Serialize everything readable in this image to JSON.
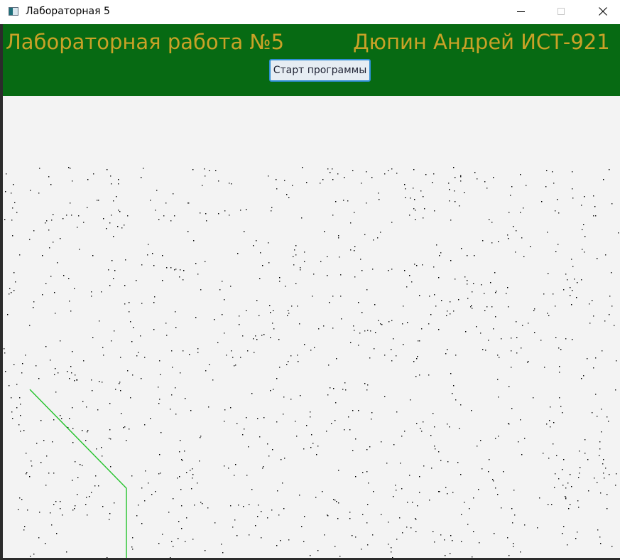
{
  "window": {
    "title": "Лабораторная 5",
    "icon": "app-window-icon",
    "controls": {
      "minimize": "minimize-icon",
      "maximize": "maximize-icon",
      "close": "close-icon"
    }
  },
  "header": {
    "left_text": "Лабораторная работа №5",
    "right_text": "Дюпин Андрей ИСТ-921",
    "background_color": "#076a13",
    "text_color": "#c9a227"
  },
  "start_button": {
    "label": "Старт программы"
  },
  "canvas": {
    "background_color": "#f3f3f3",
    "dot_color": "#000000",
    "line_color": "#22c22a"
  }
}
